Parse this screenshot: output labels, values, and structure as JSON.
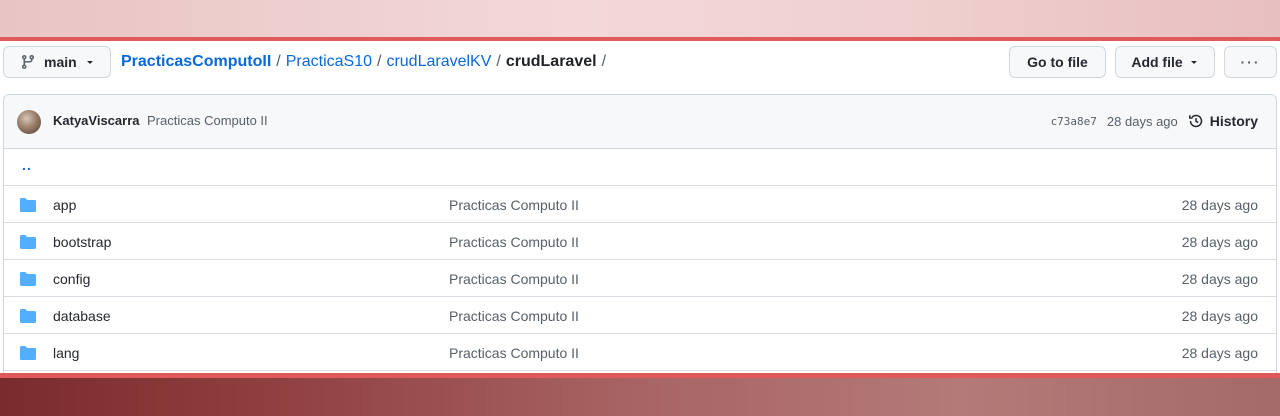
{
  "nav": {
    "branch": "main",
    "breadcrumbs": [
      "PracticasComputoII",
      "PracticaS10",
      "crudLaravelKV"
    ],
    "current": "crudLaravel",
    "trailing_sep": "/",
    "go_to_file": "Go to file",
    "add_file": "Add file",
    "more": "···"
  },
  "commit": {
    "author": "KatyaViscarra",
    "message": "Practicas Computo II",
    "sha": "c73a8e7",
    "age": "28 days ago",
    "history": "History"
  },
  "parent_link": "..",
  "files": [
    {
      "name": "app",
      "message": "Practicas Computo II",
      "age": "28 days ago"
    },
    {
      "name": "bootstrap",
      "message": "Practicas Computo II",
      "age": "28 days ago"
    },
    {
      "name": "config",
      "message": "Practicas Computo II",
      "age": "28 days ago"
    },
    {
      "name": "database",
      "message": "Practicas Computo II",
      "age": "28 days ago"
    },
    {
      "name": "lang",
      "message": "Practicas Computo II",
      "age": "28 days ago"
    }
  ],
  "colors": {
    "link": "#0969da",
    "folder": "#54aeff",
    "accent_line": "#e05a5a"
  }
}
